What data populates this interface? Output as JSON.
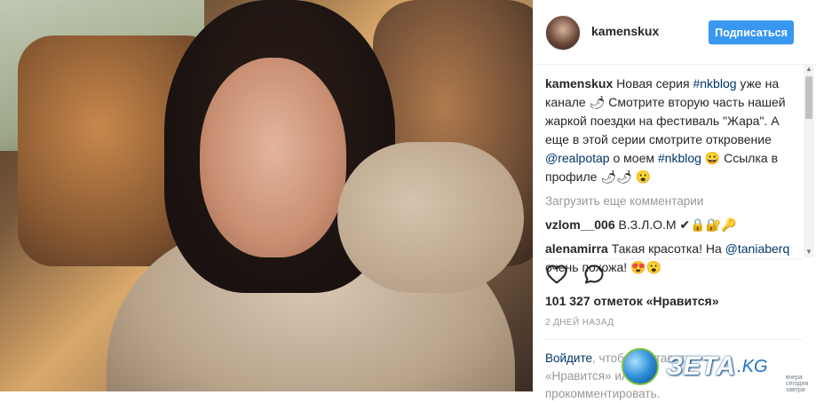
{
  "post": {
    "username": "kamenskux",
    "follow_label": "Подписаться",
    "caption_user": "kamenskux",
    "caption_parts": {
      "t1": " Новая серия ",
      "tag1": "#nkblog",
      "t2": " уже на канале 🌶 Смотрите вторую часть нашей жаркой поездки на фестиваль \"Жара\". А еще в этой серии смотрите откровение ",
      "mention1": "@realpotap",
      "t3": " о моем ",
      "tag2": "#nkblog",
      "t4": " 😀 Ссылка в профиле 🌶🌶 😮"
    },
    "load_more": "Загрузить еще комментарии",
    "comments": [
      {
        "user": "vzlom__006",
        "text": " В.З.Л.О.М ✔🔒🔐🔑"
      },
      {
        "user": "alenamirra",
        "text_a": " Такая красотка! На ",
        "mention": "@taniaberq",
        "text_b": " очень похожа! 😍😮"
      }
    ],
    "likes": "101 327 отметок «Нравится»",
    "time": "2 ДНЕЙ НАЗАД",
    "login": {
      "link": "Войдите",
      "text": ", чтобы поставить «Нравится» или прокомментировать."
    }
  },
  "icons": {
    "like": "heart-icon",
    "comment": "comment-icon"
  },
  "colors": {
    "follow_button": "#3897f0",
    "link": "#003569"
  },
  "watermark": {
    "brand": "ЗЕТА",
    "tld": ".KG",
    "tagline": "вчера сегодня завтра"
  }
}
